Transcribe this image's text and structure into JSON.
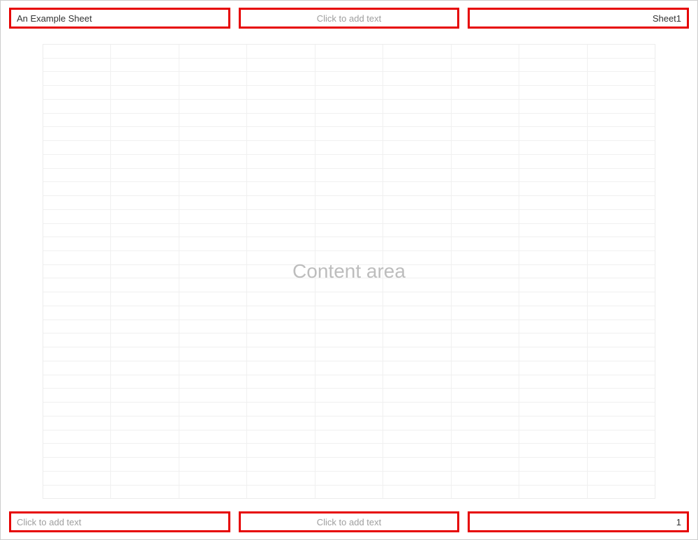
{
  "header": {
    "left": {
      "value": "An Example Sheet",
      "is_placeholder": false
    },
    "center": {
      "value": "Click to add text",
      "is_placeholder": true
    },
    "right": {
      "value": "Sheet1",
      "is_placeholder": false
    }
  },
  "content": {
    "label": "Content area",
    "grid": {
      "cols": 9,
      "rows": 33
    }
  },
  "footer": {
    "left": {
      "value": "Click to add text",
      "is_placeholder": true
    },
    "center": {
      "value": "Click to add text",
      "is_placeholder": true
    },
    "right": {
      "value": "1",
      "is_placeholder": false
    }
  }
}
